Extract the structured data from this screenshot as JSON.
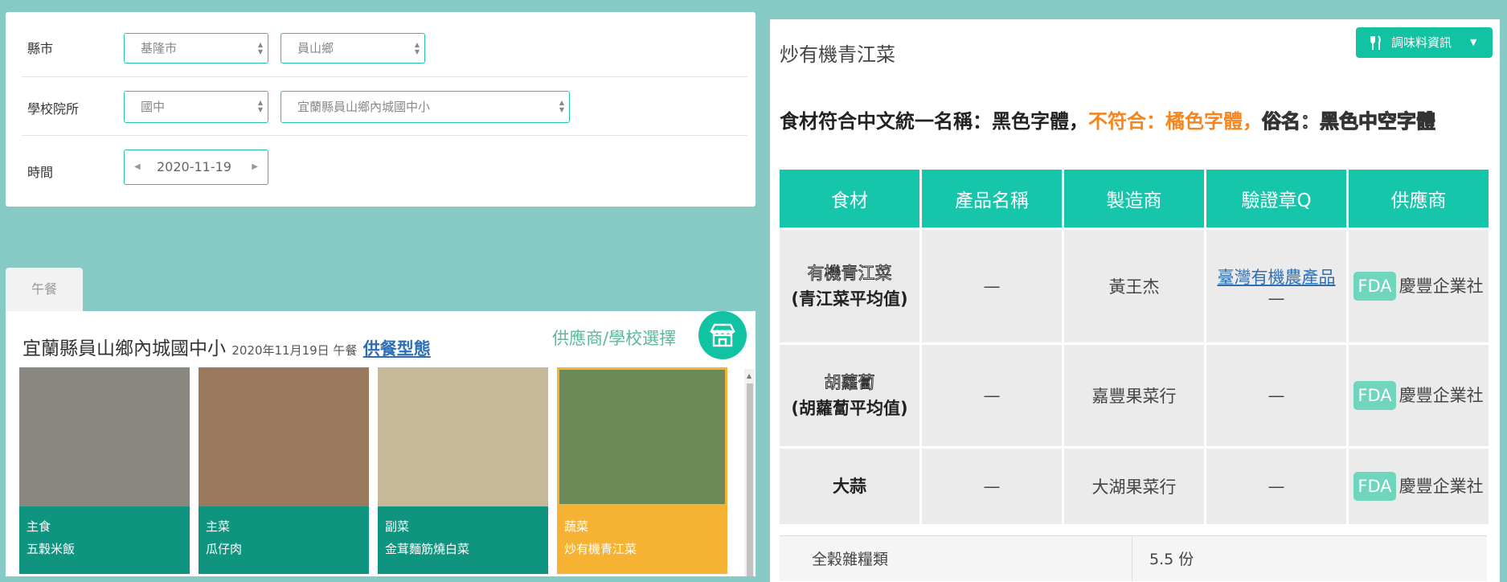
{
  "filters": {
    "county_label": "縣市",
    "county_value": "基隆市",
    "town_value": "員山鄉",
    "school_label": "學校院所",
    "school_level_value": "國中",
    "school_value": "宜蘭縣員山鄉內城國中小",
    "date_label": "時間",
    "date_value": "2020-11-19"
  },
  "lunch_tab": "午餐",
  "menu": {
    "school": "宜蘭縣員山鄉內城國中小",
    "date_meal": "2020年11月19日 午餐",
    "supply_link": "供餐型態",
    "supplier_select": "供應商/學校選擇",
    "dishes": [
      {
        "category": "主食",
        "name": "五穀米飯",
        "photo_color": "#8a8680"
      },
      {
        "category": "主菜",
        "name": "瓜仔肉",
        "photo_color": "#9a7a5e"
      },
      {
        "category": "副菜",
        "name": "金茸麵筋燒白菜",
        "photo_color": "#c8b89a"
      },
      {
        "category": "蔬菜",
        "name": "炒有機青江菜",
        "photo_color": "#6b8a58"
      }
    ]
  },
  "detail": {
    "title": "炒有機青江菜",
    "seasoning_button": "調味料資訊",
    "legend": {
      "part1": "食材符合中文統一名稱：黑色字體，",
      "part2": "不符合：橘色字體，",
      "part3": "俗名：黑色中空字體"
    },
    "headers": [
      "食材",
      "產品名稱",
      "製造商",
      "驗證章Q",
      "供應商"
    ],
    "rows": [
      {
        "common": "有機青江菜",
        "std": "(青江菜平均值)",
        "product": "—",
        "maker": "黃王杰",
        "cert_link": "臺灣有機農產品",
        "cert_extra": "—",
        "fda": "FDA",
        "supplier": "慶豐企業社"
      },
      {
        "common": "胡蘿蔔",
        "std": "(胡蘿蔔平均值)",
        "product": "—",
        "maker": "嘉豐果菜行",
        "cert": "—",
        "fda": "FDA",
        "supplier": "慶豐企業社"
      },
      {
        "name": "大蒜",
        "product": "—",
        "maker": "大湖果菜行",
        "cert": "—",
        "fda": "FDA",
        "supplier": "慶豐企業社"
      }
    ],
    "nutrition": {
      "label": "全穀雜糧類",
      "value": "5.5 份"
    }
  },
  "colors": {
    "background": "#86c9c5",
    "accent": "#12c3a3",
    "orange": "#f7851f",
    "highlight": "#f6b333"
  }
}
